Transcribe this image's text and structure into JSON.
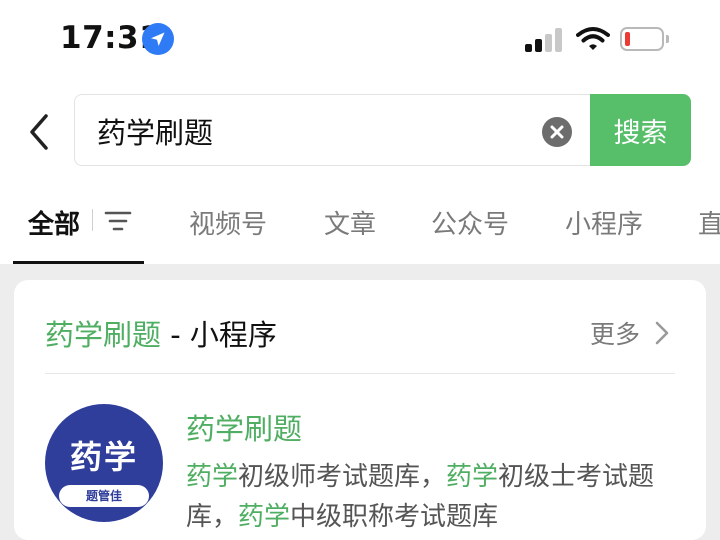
{
  "status_bar": {
    "time": "17:31",
    "battery_level": 0.15
  },
  "search": {
    "value": "药学刷题",
    "button_label": "搜索"
  },
  "tabs": {
    "items": [
      {
        "label": "全部",
        "active": true
      },
      {
        "label": "视频号"
      },
      {
        "label": "文章"
      },
      {
        "label": "公众号"
      },
      {
        "label": "小程序"
      },
      {
        "label": "直"
      }
    ]
  },
  "result": {
    "title_highlight": "药学刷题",
    "title_suffix": " - 小程序",
    "more_label": "更多",
    "logo_text": "药学",
    "logo_sub": "题管佳",
    "app_name": "药学刷题",
    "desc_parts": [
      "药学",
      "初级师考试题库，",
      "药学",
      "初级士考试题库，",
      "药学",
      "中级职称考试题库"
    ]
  },
  "colors": {
    "accent_green": "#57be6a",
    "highlight_green": "#4fae62",
    "location_blue": "#2f7bf6",
    "battery_red": "#ec3b35",
    "logo_navy": "#2f3e9b"
  }
}
